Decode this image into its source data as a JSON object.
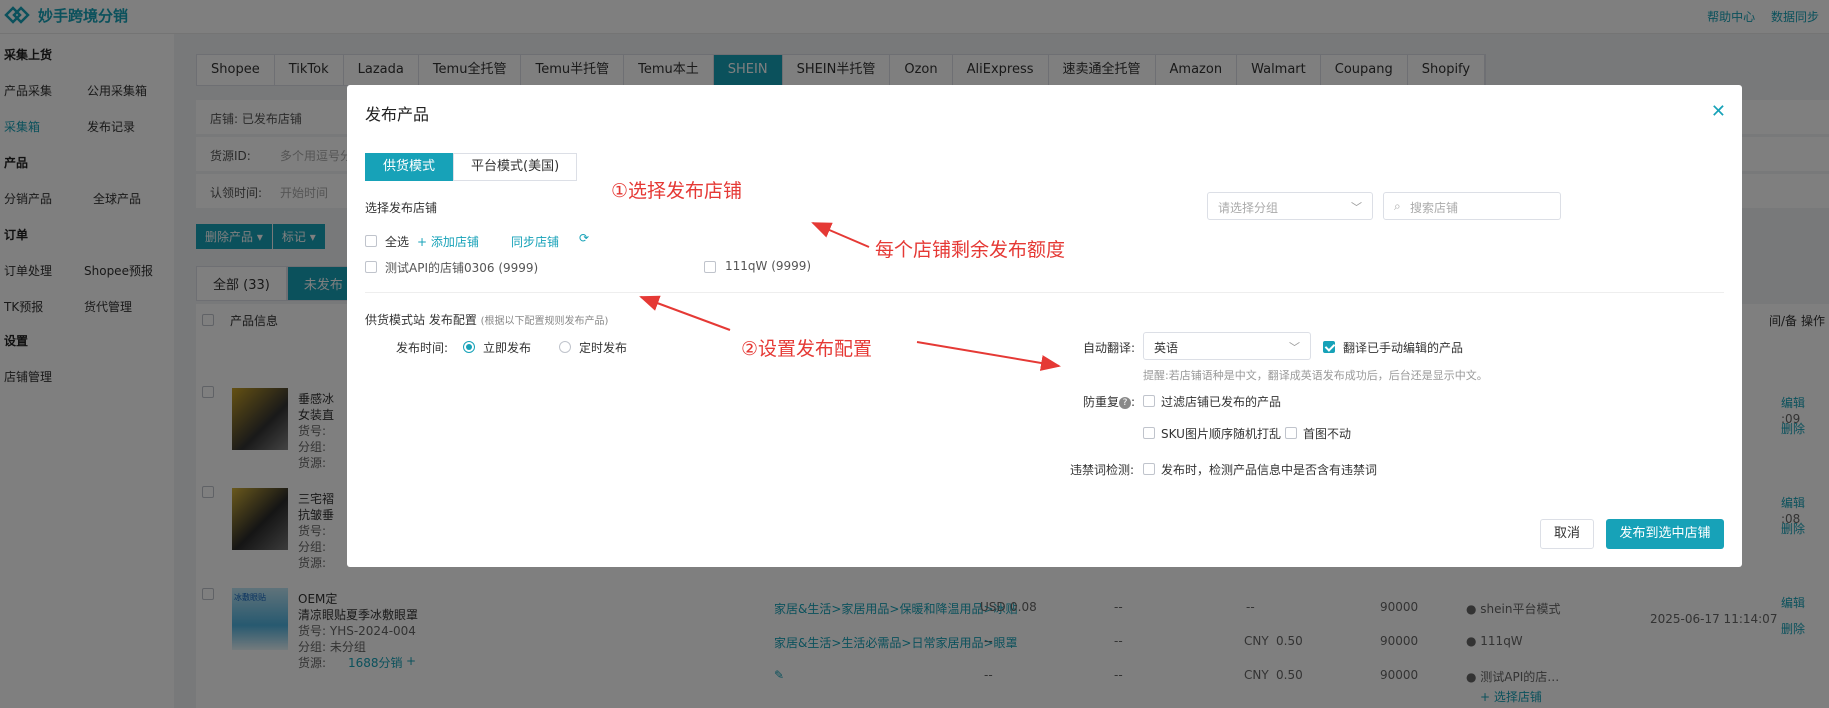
{
  "app": {
    "title": "妙手跨境分销"
  },
  "header": {
    "help_label": "帮助中心",
    "sync_label": "数据同步"
  },
  "sidebar": {
    "sections": [
      {
        "title": "采集上货",
        "items": [
          "产品采集",
          "公用采集箱",
          "采集箱",
          "发布记录"
        ]
      },
      {
        "title": "产品",
        "items": [
          "分销产品",
          "全球产品"
        ]
      },
      {
        "title": "订单",
        "items": [
          "订单处理",
          "Shopee预报",
          "TK预报",
          "货代管理"
        ]
      },
      {
        "title": "设置",
        "items": [
          "店铺管理"
        ]
      }
    ],
    "active_item": "采集箱"
  },
  "platform_tabs": [
    "Shopee",
    "TikTok",
    "Lazada",
    "Temu全托管",
    "Temu半托管",
    "Temu本土",
    "SHEIN",
    "SHEIN半托管",
    "Ozon",
    "AliExpress",
    "速卖通全托管",
    "Amazon",
    "Walmart",
    "Coupang",
    "Shopify"
  ],
  "active_platform": "SHEIN",
  "filters": {
    "store_label": "店铺: 已发布店铺",
    "source_label": "货源ID:",
    "source_placeholder": "多个用逗号分隔",
    "claim_label": "认领时间:",
    "claim_placeholder": "开始时间"
  },
  "actions": {
    "delete": "删除产品",
    "mark": "标记"
  },
  "status_tabs": {
    "all": "全部 (33)",
    "unpublished": "未发布 ("
  },
  "table": {
    "header_product": "产品信息",
    "header_op": "操作",
    "header_partial": "间/备",
    "rows": [
      {
        "title1": "垂感冰",
        "title2": "女装直",
        "l1": "货号:",
        "l2": "分组:",
        "l3": "货源:",
        "time": ":09",
        "edit": "编辑",
        "del": "删除"
      },
      {
        "title1": "三宅褶",
        "title2": "抗皱垂",
        "l1": "货号:",
        "l2": "分组:",
        "l3": "货源:",
        "time": ":08",
        "edit": "编辑",
        "del": "删除"
      },
      {
        "title1": "OEM定",
        "title2": "清凉眼贴夏季冰敷眼罩",
        "l1": "货号: YHS-2024-004",
        "l2": "分组: 未分组",
        "l3": "货源:",
        "source_link": "1688分销",
        "plus": "+",
        "time": "2025-06-17 11:14:07",
        "edit": "编辑",
        "del": "删除"
      }
    ],
    "thumb_text": "冰敷眼贴",
    "sub_rows": [
      {
        "cat": "家居&生活>家居用品>保暖和降温用品>冰贴",
        "cur": "USD",
        "price": "0.08",
        "dash1": "--",
        "dash2": "--",
        "stock": "90000",
        "store": "● shein平台模式"
      },
      {
        "cat": "家居&生活>生活必需品>日常家居用品>眼罩",
        "cur": "CNY",
        "price": "0.50",
        "dash1": "--",
        "dash2": "--",
        "stock": "90000",
        "store": "● 111qW"
      },
      {
        "cat": "",
        "cur": "CNY",
        "price": "0.50",
        "dash1": "--",
        "dash2": "--",
        "stock": "90000",
        "store": "● 测试API的店…"
      }
    ],
    "select_store": "+ 选择店铺"
  },
  "dialog": {
    "title": "发布产品",
    "modes": [
      "供货模式",
      "平台模式(美国)"
    ],
    "active_mode": "供货模式",
    "select_store_label": "选择发布店铺",
    "group_placeholder": "请选择分组",
    "search_placeholder": "搜索店铺",
    "select_all": "全选",
    "add_store": "+ 添加店铺",
    "sync_store": "同步店铺",
    "stores": [
      "测试API的店铺0306 (9999)",
      "111qW (9999)"
    ],
    "config_title": "供货模式站 发布配置",
    "config_note": "(根据以下配置规则发布产品)",
    "publish_time_label": "发布时间:",
    "publish_now": "立即发布",
    "publish_scheduled": "定时发布",
    "auto_translate_label": "自动翻译:",
    "translate_lang": "英语",
    "translate_edited": "翻译已手动编辑的产品",
    "translate_hint": "提醒:若店铺语种是中文，翻译成英语发布成功后，后台还是显示中文。",
    "dedup_label": "防重复",
    "dedup_filter": "过滤店铺已发布的产品",
    "sku_shuffle": "SKU图片顺序随机打乱",
    "first_image": "首图不动",
    "banned_label": "违禁词检测:",
    "banned_check": "发布时，检测产品信息中是否含有违禁词",
    "cancel": "取消",
    "publish": "发布到选中店铺"
  },
  "annotations": {
    "step1": "①选择发布店铺",
    "quota": "每个店铺剩余发布额度",
    "step2": "②设置发布配置"
  },
  "colors": {
    "accent": "#17a2b8",
    "annotation": "#e53935"
  }
}
